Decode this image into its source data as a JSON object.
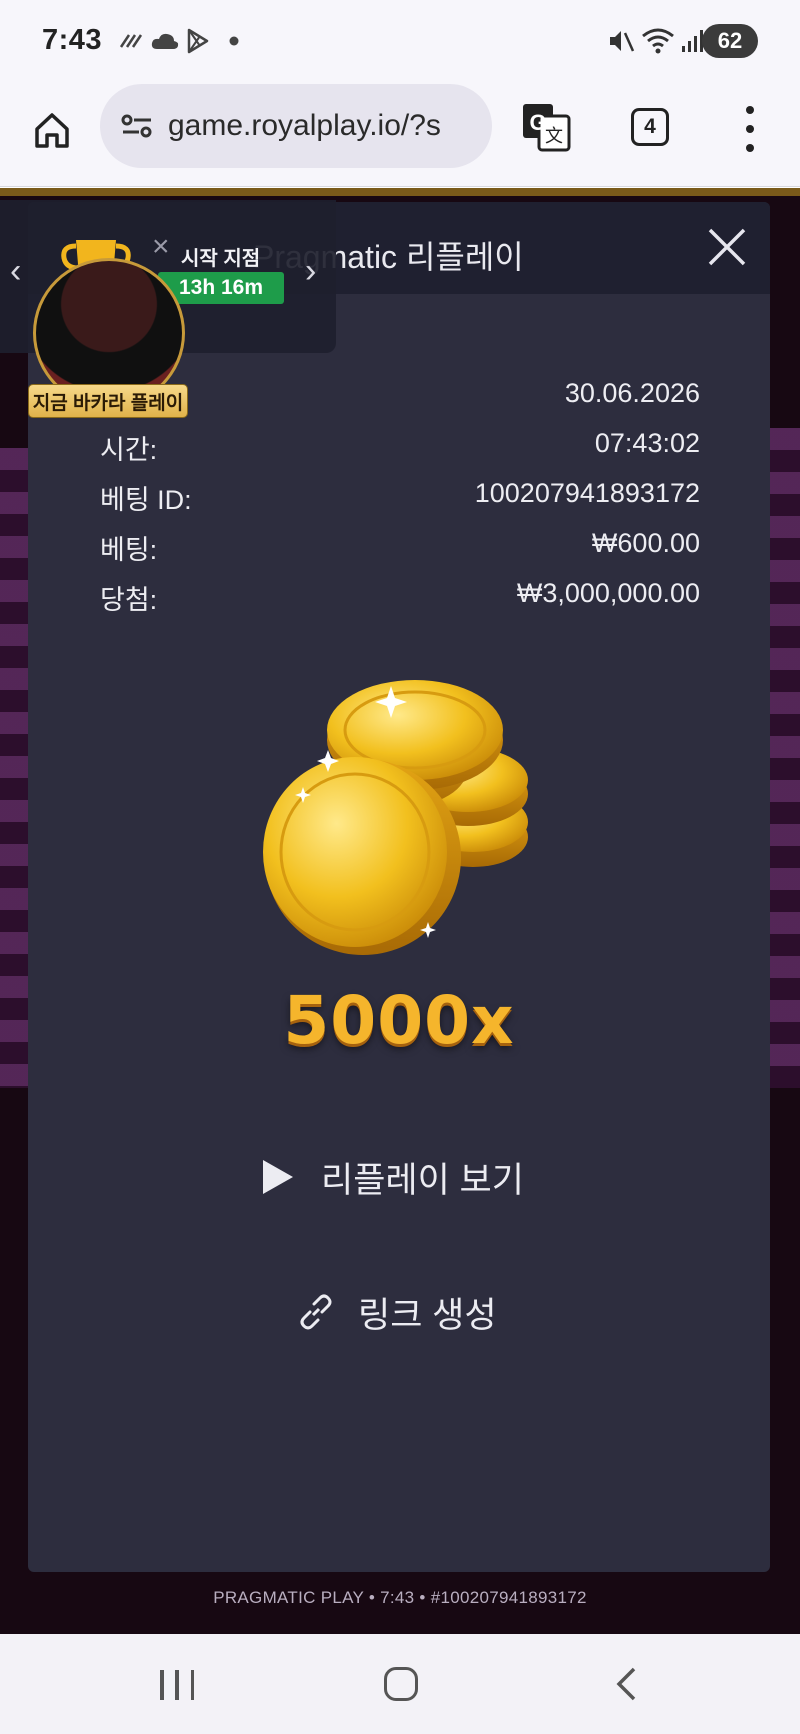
{
  "status_bar": {
    "time": "7:43",
    "battery": "62",
    "left_icons": [
      "sync-icon",
      "cloud-icon",
      "play-store-icon",
      "dot-icon"
    ],
    "right_icons": [
      "mute-icon",
      "wifi-icon",
      "signal-icon"
    ]
  },
  "browser": {
    "url": "game.royalplay.io/?s",
    "tab_count": "4"
  },
  "promo": {
    "label": "시작 지점",
    "timer": "13h 16m",
    "badge": "지금 바카라 플레이"
  },
  "modal": {
    "title": "Pragmatic 리플레이",
    "rows": [
      {
        "label": "",
        "value": "30.06.2026"
      },
      {
        "label": "시간:",
        "value": "07:43:02"
      },
      {
        "label": "베팅 ID:",
        "value": "100207941893172"
      },
      {
        "label": "베팅:",
        "value": "₩600.00"
      },
      {
        "label": "당첨:",
        "value": "₩3,000,000.00"
      }
    ],
    "multiplier": "5000x",
    "replay_label": "리플레이 보기",
    "link_label": "링크 생성"
  },
  "footer": {
    "info": "PRAGMATIC PLAY • 7:43 • #100207941893172"
  },
  "colors": {
    "modal_bg": "#2d2d3e",
    "modal_header": "#1f2030",
    "multiplier": "#f5b52c",
    "timer_bg": "#1e9c4a"
  }
}
